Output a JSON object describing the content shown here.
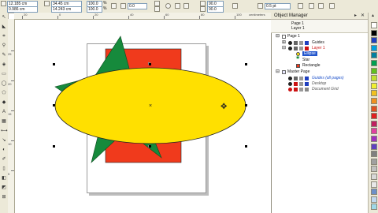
{
  "propbar": {
    "x_value": "12.185 cm",
    "y_value": "0.986 cm",
    "width_value": "34.45 cm",
    "height_value": "14.243 cm",
    "scale_x": "100.0",
    "scale_y": "100.0",
    "pct": "%",
    "rotation": "0.0",
    "angle1": "90.0",
    "angle2": "90.0",
    "outline_width": "0.5 pt"
  },
  "ruler": {
    "h_labels": [
      "20",
      "0",
      "20",
      "40",
      "60",
      "80",
      "100"
    ],
    "h_unit": "centimeters",
    "v_labels": [
      "25",
      "20",
      "15",
      "10",
      "5"
    ]
  },
  "docker": {
    "title": "Object Manager",
    "info_line1": "Page 1",
    "info_line2": "Layer 1",
    "page1": "Page 1",
    "guides": "Guides",
    "layer1": "Layer 1",
    "ellipse": "Ellipse",
    "star": "Star",
    "rectangle": "Rectangle",
    "master_page": "Master Page",
    "guides_all": "Guides (all pages)",
    "desktop": "Desktop",
    "document_grid": "Document Grid"
  },
  "palette_colors": [
    "#ffffff",
    "#000000",
    "#1f3fbf",
    "#00a0e0",
    "#0080a0",
    "#00a050",
    "#60c020",
    "#c0e030",
    "#f0f030",
    "#f0c020",
    "#f09020",
    "#e05020",
    "#e02020",
    "#c02060",
    "#e040a0",
    "#a030c0",
    "#6040c0",
    "#808080",
    "#a0a0a0",
    "#c0c0c0",
    "#d8d8d8",
    "#e8e8e8",
    "#6e90c8",
    "#c0d8f0",
    "#9fd8e8"
  ],
  "colors": {
    "ellipse_fill": "#ffe000",
    "star_fill": "#168a3c",
    "rect_fill": "#f03a1c",
    "layer_red": "#cc1111",
    "selection_blue": "#2255cc"
  }
}
